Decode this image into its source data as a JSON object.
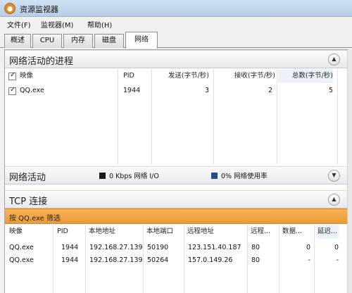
{
  "window": {
    "title": "资源监视器"
  },
  "menu": [
    "文件(F)",
    "监视器(M)",
    "帮助(H)"
  ],
  "tabs": [
    "概述",
    "CPU",
    "内存",
    "磁盘",
    "网络"
  ],
  "active_tab": "网络",
  "processes_section": {
    "title": "网络活动的进程",
    "columns": [
      "映像",
      "PID",
      "发送(字节/秒)",
      "接收(字节/秒)",
      "总数(字节/秒)"
    ],
    "rows": [
      {
        "image": "QQ.exe",
        "pid": "1944",
        "send": "3",
        "recv": "2",
        "total": "5",
        "checked": true
      }
    ]
  },
  "network_activity_section": {
    "title": "网络活动",
    "io_label": "0 Kbps 网络 I/O",
    "usage_label": "0% 网络使用率",
    "io_color": "#1a1a1a",
    "usage_color": "#1f4f8a"
  },
  "tcp_section": {
    "title": "TCP 连接",
    "filter_text": "按 QQ.exe 筛选",
    "filter_color": "#f0a040",
    "columns": [
      "映像",
      "PID",
      "本地地址",
      "本地端口",
      "远程地址",
      "远程...",
      "数据...",
      "延迟..."
    ],
    "rows": [
      {
        "image": "QQ.exe",
        "pid": "1944",
        "local_addr": "192.168.27.139",
        "local_port": "50190",
        "remote_addr": "123.151.40.187",
        "remote_port": "80",
        "packet_loss": "0",
        "latency": "0"
      },
      {
        "image": "QQ.exe",
        "pid": "1944",
        "local_addr": "192.168.27.139",
        "local_port": "50264",
        "remote_addr": "157.0.149.26",
        "remote_port": "80",
        "packet_loss": "-",
        "latency": "-"
      }
    ]
  },
  "icons": {
    "app": "resource-monitor-icon",
    "collapse_up": "chevron-up-icon",
    "expand_down": "chevron-down-icon",
    "checkbox": "checkbox-checked-icon"
  }
}
